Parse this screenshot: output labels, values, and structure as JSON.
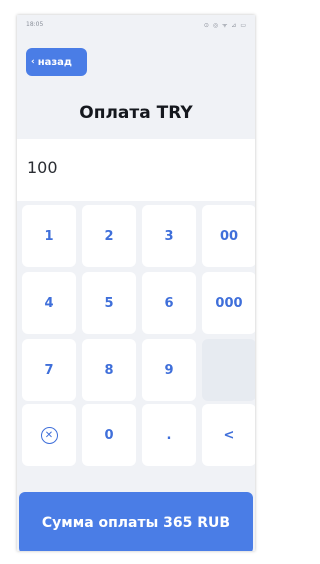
{
  "status_bar": {
    "time": "18:05",
    "icons_text": "⊙ ◎ ᯤ ⊿ ▭"
  },
  "header": {
    "back_label": "назад",
    "title": "Оплата TRY"
  },
  "amount": {
    "value": "100"
  },
  "keypad": {
    "keys": [
      {
        "label": "1",
        "name": "key-1"
      },
      {
        "label": "2",
        "name": "key-2"
      },
      {
        "label": "3",
        "name": "key-3"
      },
      {
        "label": "00",
        "name": "key-00"
      },
      {
        "label": "4",
        "name": "key-4"
      },
      {
        "label": "5",
        "name": "key-5"
      },
      {
        "label": "6",
        "name": "key-6"
      },
      {
        "label": "000",
        "name": "key-000"
      },
      {
        "label": "7",
        "name": "key-7"
      },
      {
        "label": "8",
        "name": "key-8"
      },
      {
        "label": "9",
        "name": "key-9"
      },
      {
        "label": "",
        "name": "key-empty"
      },
      {
        "label": "✕",
        "name": "clear-key",
        "icon": "clear-circle-icon"
      },
      {
        "label": "0",
        "name": "key-0"
      },
      {
        "label": ".",
        "name": "key-decimal"
      },
      {
        "label": "<",
        "name": "backspace-key"
      }
    ]
  },
  "submit": {
    "label": "Сумма оплаты 365 RUB"
  },
  "colors": {
    "accent": "#4a7de6",
    "key_text": "#3f6fda",
    "background": "#f0f2f6"
  }
}
